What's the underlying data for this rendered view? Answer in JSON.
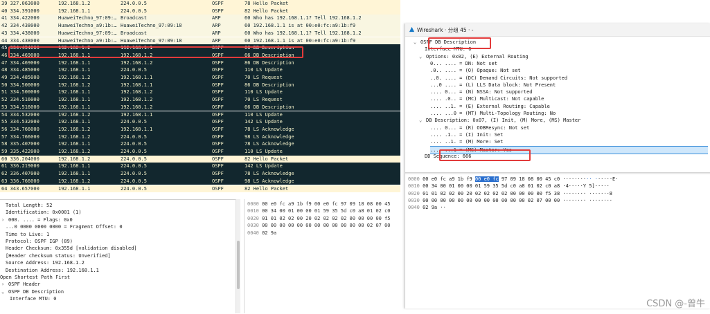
{
  "packet_list": {
    "rows": [
      {
        "no": "39 327.063000",
        "src": "192.168.1.2",
        "dst": "224.0.0.5",
        "proto": "OSPF",
        "info": "78 Hello Packet",
        "tone": "ospf"
      },
      {
        "no": "40 334.391000",
        "src": "192.168.1.1",
        "dst": "224.0.0.5",
        "proto": "OSPF",
        "info": "82 Hello Packet",
        "tone": "ospf"
      },
      {
        "no": "41 334.422000",
        "src": "HuaweiTechno_97:09:…",
        "dst": "Broadcast",
        "proto": "ARP",
        "info": "60 Who has 192.168.1.1? Tell 192.168.1.2",
        "tone": "arp"
      },
      {
        "no": "42 334.438000",
        "src": "HuaweiTechno_a9:1b:…",
        "dst": "HuaweiTechno_97:09:18",
        "proto": "ARP",
        "info": "60 192.168.1.1 is at 00:e0:fc:a9:1b:f9",
        "tone": "arp"
      },
      {
        "no": "43 334.438000",
        "src": "HuaweiTechno_97:09:…",
        "dst": "Broadcast",
        "proto": "ARP",
        "info": "60 Who has 192.168.1.1? Tell 192.168.1.2",
        "tone": "arp"
      },
      {
        "no": "44 334.438000",
        "src": "HuaweiTechno_a9:1b:…",
        "dst": "HuaweiTechno_97:09:18",
        "proto": "ARP",
        "info": "60 192.168.1.1 is at 00:e0:fc:a9:1b:f9",
        "tone": "arp"
      },
      {
        "no": "45 334.454000",
        "src": "192.168.1.2",
        "dst": "192.168.1.1",
        "proto": "OSPF",
        "info": "66 DB Description",
        "tone": "sel"
      },
      {
        "no": "46 334.469000",
        "src": "192.168.1.1",
        "dst": "192.168.1.2",
        "proto": "OSPF",
        "info": "66 DB Description",
        "tone": "dark"
      },
      {
        "no": "47 334.469000",
        "src": "192.168.1.1",
        "dst": "192.168.1.2",
        "proto": "OSPF",
        "info": "86 DB Description",
        "tone": "dark"
      },
      {
        "no": "48 334.485000",
        "src": "192.168.1.1",
        "dst": "224.0.0.5",
        "proto": "OSPF",
        "info": "110 LS Update",
        "tone": "dark"
      },
      {
        "no": "49 334.485000",
        "src": "192.168.1.2",
        "dst": "192.168.1.1",
        "proto": "OSPF",
        "info": "70 LS Request",
        "tone": "dark"
      },
      {
        "no": "50 334.500000",
        "src": "192.168.1.2",
        "dst": "192.168.1.1",
        "proto": "OSPF",
        "info": "86 DB Description",
        "tone": "dark"
      },
      {
        "no": "51 334.500000",
        "src": "192.168.1.1",
        "dst": "192.168.1.2",
        "proto": "OSPF",
        "info": "110 LS Update",
        "tone": "dark"
      },
      {
        "no": "52 334.516000",
        "src": "192.168.1.1",
        "dst": "192.168.1.2",
        "proto": "OSPF",
        "info": "70 LS Request",
        "tone": "dark"
      },
      {
        "no": "53 334.516000",
        "src": "192.168.1.1",
        "dst": "192.168.1.2",
        "proto": "OSPF",
        "info": "66 DB Description",
        "tone": "dark"
      },
      {
        "no": "54 334.532000",
        "src": "192.168.1.2",
        "dst": "192.168.1.1",
        "proto": "OSPF",
        "info": "110 LS Update",
        "tone": "dark"
      },
      {
        "no": "55 334.532000",
        "src": "192.168.1.1",
        "dst": "224.0.0.5",
        "proto": "OSPF",
        "info": "142 LS Update",
        "tone": "dark"
      },
      {
        "no": "56 334.766000",
        "src": "192.168.1.2",
        "dst": "192.168.1.1",
        "proto": "OSPF",
        "info": "78 LS Acknowledge",
        "tone": "dark"
      },
      {
        "no": "57 334.766000",
        "src": "192.168.1.2",
        "dst": "224.0.0.5",
        "proto": "OSPF",
        "info": "98 LS Acknowledge",
        "tone": "dark"
      },
      {
        "no": "58 335.407000",
        "src": "192.168.1.1",
        "dst": "224.0.0.5",
        "proto": "OSPF",
        "info": "78 LS Acknowledge",
        "tone": "dark"
      },
      {
        "no": "59 335.422000",
        "src": "192.168.1.2",
        "dst": "224.0.0.5",
        "proto": "OSPF",
        "info": "110 LS Update",
        "tone": "dark"
      },
      {
        "no": "60 336.204000",
        "src": "192.168.1.2",
        "dst": "224.0.0.5",
        "proto": "OSPF",
        "info": "82 Hello Packet",
        "tone": "ospf"
      },
      {
        "no": "61 336.219000",
        "src": "192.168.1.1",
        "dst": "224.0.0.5",
        "proto": "OSPF",
        "info": "142 LS Update",
        "tone": "dark"
      },
      {
        "no": "62 336.407000",
        "src": "192.168.1.1",
        "dst": "224.0.0.5",
        "proto": "OSPF",
        "info": "78 LS Acknowledge",
        "tone": "dark"
      },
      {
        "no": "63 336.766000",
        "src": "192.168.1.2",
        "dst": "224.0.0.5",
        "proto": "OSPF",
        "info": "98 LS Acknowledge",
        "tone": "dark"
      },
      {
        "no": "64 343.657000",
        "src": "192.168.1.1",
        "dst": "224.0.0.5",
        "proto": "OSPF",
        "info": "82 Hello Packet",
        "tone": "ospf"
      }
    ]
  },
  "left_details": [
    {
      "arrow": "",
      "indent": 1,
      "text": "Total Length: 52"
    },
    {
      "arrow": "",
      "indent": 1,
      "text": "Identification: 0x0001 (1)"
    },
    {
      "arrow": ">",
      "indent": 0,
      "text": "000. .... = Flags: 0x0"
    },
    {
      "arrow": "",
      "indent": 1,
      "text": "...0 0000 0000 0000 = Fragment Offset: 0"
    },
    {
      "arrow": "",
      "indent": 1,
      "text": "Time to Live: 1"
    },
    {
      "arrow": "",
      "indent": 1,
      "text": "Protocol: OSPF IGP (89)"
    },
    {
      "arrow": "",
      "indent": 1,
      "text": "Header Checksum: 0x355d [validation disabled]"
    },
    {
      "arrow": "",
      "indent": 1,
      "text": "[Header checksum status: Unverified]"
    },
    {
      "arrow": "",
      "indent": 1,
      "text": "Source Address: 192.168.1.2"
    },
    {
      "arrow": "",
      "indent": 1,
      "text": "Destination Address: 192.168.1.1"
    },
    {
      "arrow": "",
      "indent": -1,
      "text": "Open Shortest Path First"
    },
    {
      "arrow": ">",
      "indent": 0,
      "text": "OSPF Header"
    },
    {
      "arrow": "v",
      "indent": 0,
      "text": "OSPF DB Description"
    },
    {
      "arrow": "",
      "indent": 2,
      "text": "Interface MTU: 0"
    }
  ],
  "left_hex": [
    {
      "off": "0000",
      "bytes": "00 e0 fc a9 1b f9 00 e0  fc 97 09 18 08 00 45"
    },
    {
      "off": "0010",
      "bytes": "00 34 00 01 00 00 01 59  35 5d c0 a8 01 02 c0"
    },
    {
      "off": "0020",
      "bytes": "01 01 02 02 00 20 02 02  02 02 00 00 00 00 f5"
    },
    {
      "off": "0030",
      "bytes": "00 00 00 00 00 00 00 00  00 00 00 00 02 07 00"
    },
    {
      "off": "0040",
      "bytes": "02 9a"
    }
  ],
  "right_window": {
    "title": "Wireshark · 分组 45 · -",
    "tree": [
      {
        "arrow": "v",
        "indent": 0,
        "prefix": "OSPF ",
        "text": "DB Description",
        "selected": false
      },
      {
        "arrow": "",
        "indent": 2,
        "prefix": "",
        "text": "Interface MTU: 0",
        "selected": false
      },
      {
        "arrow": "v",
        "indent": 1,
        "prefix": "",
        "text": "Options: 0x02, (E) External Routing",
        "selected": false
      },
      {
        "arrow": "",
        "indent": 3,
        "prefix": "",
        "text": "0... .... = DN: Not set",
        "selected": false
      },
      {
        "arrow": "",
        "indent": 3,
        "prefix": "",
        "text": ".0.. .... = (O) Opaque: Not set",
        "selected": false
      },
      {
        "arrow": "",
        "indent": 3,
        "prefix": "",
        "text": "..0. .... = (DC) Demand Circuits: Not supported",
        "selected": false
      },
      {
        "arrow": "",
        "indent": 3,
        "prefix": "",
        "text": "...0 .... = (L) LLS Data block: Not Present",
        "selected": false
      },
      {
        "arrow": "",
        "indent": 3,
        "prefix": "",
        "text": ".... 0... = (N) NSSA: Not supported",
        "selected": false
      },
      {
        "arrow": "",
        "indent": 3,
        "prefix": "",
        "text": ".... .0.. = (MC) Multicast: Not capable",
        "selected": false
      },
      {
        "arrow": "",
        "indent": 3,
        "prefix": "",
        "text": ".... ..1. = (E) External Routing: Capable",
        "selected": false
      },
      {
        "arrow": "",
        "indent": 3,
        "prefix": "",
        "text": ".... ...0 = (MT) Multi-Topology Routing: No",
        "selected": false
      },
      {
        "arrow": "v",
        "indent": 1,
        "prefix": "",
        "text": "DB Description: 0x07, (I) Init, (M) More, (MS) Master",
        "selected": false
      },
      {
        "arrow": "",
        "indent": 3,
        "prefix": "",
        "text": ".... 0... = (R) OOBResync: Not set",
        "selected": false
      },
      {
        "arrow": "",
        "indent": 3,
        "prefix": "",
        "text": ".... .1.. = (I) Init: Set",
        "selected": false
      },
      {
        "arrow": "",
        "indent": 3,
        "prefix": "",
        "text": ".... ..1. = (M) More: Set",
        "selected": false
      },
      {
        "arrow": "",
        "indent": 3,
        "prefix": "",
        "text": ".... ...1 = (MS) Master: Yes",
        "selected": true
      },
      {
        "arrow": "",
        "indent": 2,
        "prefix": "",
        "text": "DD Sequence: 666",
        "selected": false
      }
    ],
    "hex": [
      {
        "off": "0000",
        "pre": "00 e0 fc a9 1b f9 ",
        "hl": "00 e0  fc",
        "post": " 97 09 18 08 00 45 c0",
        "ascii_pre": "········",
        "ascii_hl": "·· ·",
        "ascii_post": "·····E·"
      },
      {
        "off": "0010",
        "pre": "00 34 00 01 00 00 01 59  35 5d c0 a8 01 02 c0 a8",
        "hl": "",
        "post": "",
        "ascii_pre": "·4·····Y 5]·····",
        "ascii_hl": "",
        "ascii_post": ""
      },
      {
        "off": "0020",
        "pre": "01 01 02 02 00 20 02 02  02 02 00 00 00 00 f5 38",
        "hl": "",
        "post": "",
        "ascii_pre": "········ ·······8",
        "ascii_hl": "",
        "ascii_post": ""
      },
      {
        "off": "0030",
        "pre": "00 00 00 00 00 00 00 00  00 00 00 00 02 07 00 00",
        "hl": "",
        "post": "",
        "ascii_pre": "········ ········",
        "ascii_hl": "",
        "ascii_post": ""
      },
      {
        "off": "0040",
        "pre": "02 9a",
        "hl": "",
        "post": "",
        "ascii_pre": "··",
        "ascii_hl": "",
        "ascii_post": ""
      }
    ]
  },
  "watermark": "CSDN @-曾牛",
  "colors": {
    "dark_row": "#12272e",
    "ospf_row": "#fff5d6",
    "highlight": "#e23b3b",
    "hex_highlight": "#2a6fce"
  }
}
